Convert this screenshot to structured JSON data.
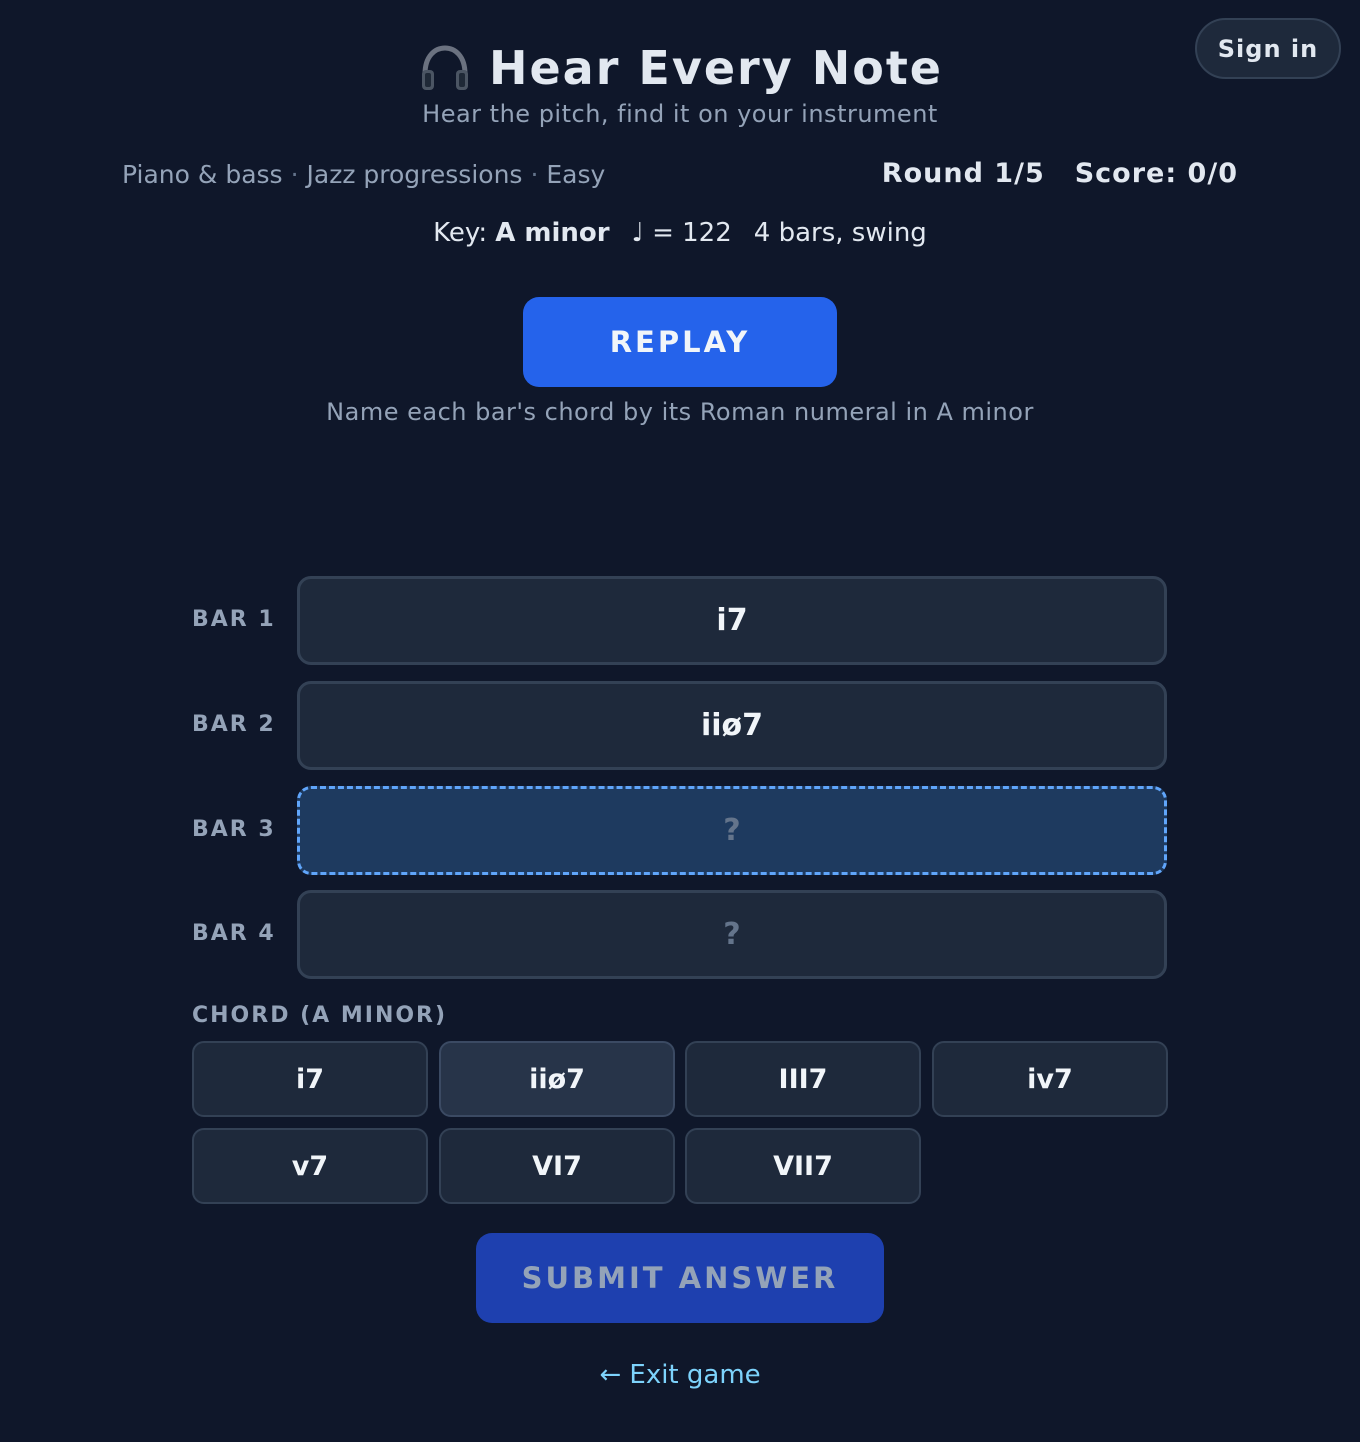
{
  "header": {
    "title": "Hear Every Note",
    "icon": "headphones-icon",
    "subtitle": "Hear the pitch, find it on your instrument",
    "sign_in_label": "Sign in"
  },
  "game_info": {
    "instrument": "Piano & bass",
    "mode": "Jazz progressions",
    "difficulty": "Easy",
    "round": "Round 1/5",
    "score": "Score: 0/0",
    "key_label": "Key:",
    "key_value": "A minor",
    "tempo": "♩ = 122",
    "bars_info": "4 bars, swing"
  },
  "controls": {
    "replay_label": "REPLAY",
    "instruction": "Name each bar's chord by its Roman numeral in A minor"
  },
  "bars": [
    {
      "label": "BAR 1",
      "value": "i7"
    },
    {
      "label": "BAR 2",
      "value": "iiø7"
    },
    {
      "label": "BAR 3",
      "value": "?"
    },
    {
      "label": "BAR 4",
      "value": "?"
    }
  ],
  "chords": {
    "heading": "CHORD (A MINOR)",
    "options": [
      "i7",
      "iiø7",
      "III7",
      "iv7",
      "v7",
      "VI7",
      "VII7"
    ]
  },
  "footer": {
    "submit_label": "SUBMIT ANSWER",
    "exit_label": "← Exit game"
  },
  "colors": {
    "background": "#0f172a",
    "accent": "#2563eb",
    "active_border": "#60a5fa",
    "link": "#7dd3fc"
  }
}
